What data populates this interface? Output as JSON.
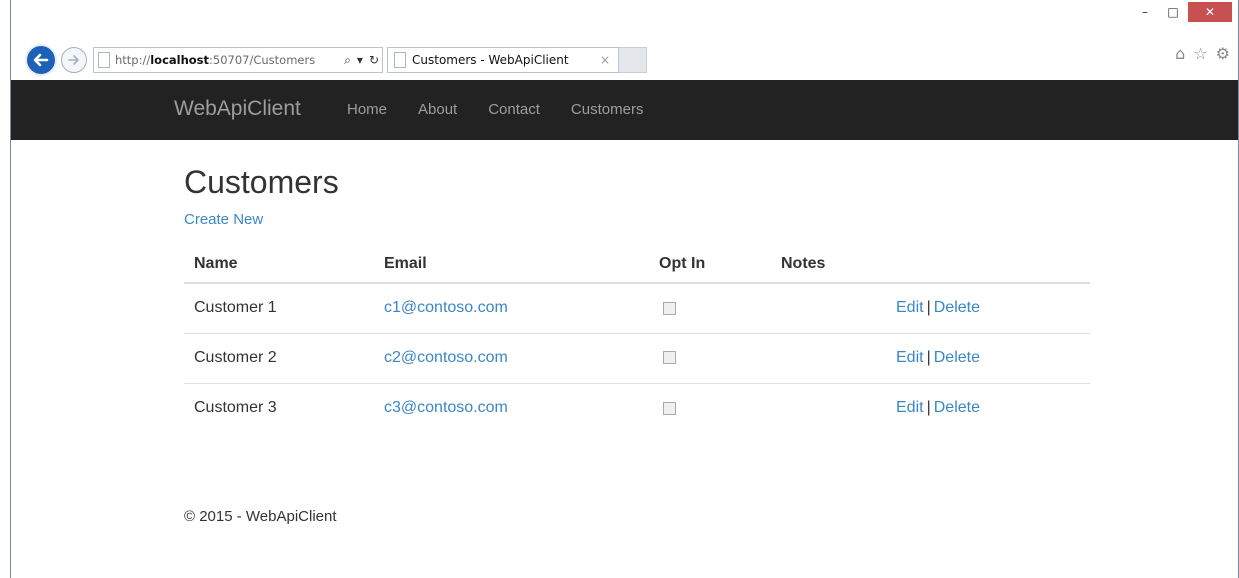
{
  "browser": {
    "url_prefix": "http://",
    "url_host": "localhost",
    "url_rest": ":50707/Customers",
    "search_glyph": "⌕",
    "dropdown_glyph": "▾",
    "refresh_glyph": "↻",
    "tab_title": "Customers - WebApiClient",
    "tab_close": "×",
    "minimize": "–",
    "maximize": "□",
    "close": "✕",
    "home_glyph": "⌂",
    "star_glyph": "☆",
    "gear_glyph": "⚙"
  },
  "navbar": {
    "brand": "WebApiClient",
    "links": [
      "Home",
      "About",
      "Contact",
      "Customers"
    ]
  },
  "page": {
    "title": "Customers",
    "create_link": "Create New"
  },
  "table": {
    "headers": [
      "Name",
      "Email",
      "Opt In",
      "Notes",
      ""
    ],
    "rows": [
      {
        "name": "Customer 1",
        "email": "c1@contoso.com",
        "opt_in": false,
        "notes": "",
        "edit": "Edit",
        "delete": "Delete"
      },
      {
        "name": "Customer 2",
        "email": "c2@contoso.com",
        "opt_in": false,
        "notes": "",
        "edit": "Edit",
        "delete": "Delete"
      },
      {
        "name": "Customer 3",
        "email": "c3@contoso.com",
        "opt_in": false,
        "notes": "",
        "edit": "Edit",
        "delete": "Delete"
      }
    ],
    "separator": "|"
  },
  "footer": {
    "text": "© 2015 - WebApiClient"
  },
  "colors": {
    "navbar_bg": "#222222",
    "navbar_text": "#9d9d9d",
    "link": "#3a87c8",
    "close_button": "#c75050",
    "back_button": "#1c62b9"
  }
}
